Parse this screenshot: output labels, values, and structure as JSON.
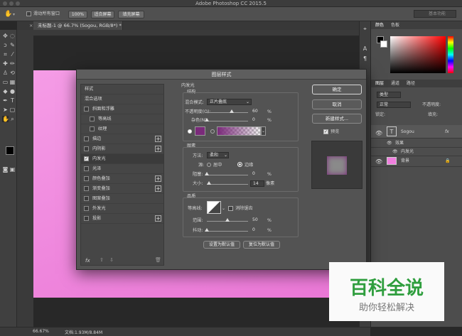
{
  "app": {
    "title": "Adobe Photoshop CC 2015.5"
  },
  "options_bar": {
    "scrub_zoom_label": "滑动所有窗口",
    "zoom_value": "100%",
    "fit_screen": "适合屏幕",
    "fill_screen": "填充屏幕",
    "workspace": "基本功能"
  },
  "document_tab": {
    "label": "未标题-1 @ 66.7% (Sogou, RGB/8*) *"
  },
  "dialog": {
    "title": "图层样式",
    "styles_header": "样式",
    "blend_options": "混合选项",
    "items": [
      {
        "label": "斜面和浮雕",
        "checked": false,
        "plus": false,
        "indent": false
      },
      {
        "label": "等高线",
        "checked": false,
        "plus": false,
        "indent": true
      },
      {
        "label": "纹理",
        "checked": false,
        "plus": false,
        "indent": true
      },
      {
        "label": "描边",
        "checked": false,
        "plus": true,
        "indent": false
      },
      {
        "label": "内阴影",
        "checked": false,
        "plus": true,
        "indent": false
      },
      {
        "label": "内发光",
        "checked": true,
        "plus": false,
        "indent": false
      },
      {
        "label": "光泽",
        "checked": false,
        "plus": false,
        "indent": false
      },
      {
        "label": "颜色叠加",
        "checked": false,
        "plus": true,
        "indent": false
      },
      {
        "label": "渐变叠加",
        "checked": false,
        "plus": true,
        "indent": false
      },
      {
        "label": "图案叠加",
        "checked": false,
        "plus": false,
        "indent": false
      },
      {
        "label": "外发光",
        "checked": false,
        "plus": false,
        "indent": false
      },
      {
        "label": "投影",
        "checked": false,
        "plus": true,
        "indent": false
      }
    ],
    "fx_label": "fx",
    "section_title": "内发光",
    "structure": {
      "title": "结构",
      "blend_mode_label": "混合模式:",
      "blend_mode_value": "正片叠底",
      "opacity_label": "不透明度(O):",
      "opacity_value": "60",
      "opacity_unit": "%",
      "opacity_level": 0.6,
      "noise_label": "杂色(N):",
      "noise_value": "0",
      "noise_unit": "%",
      "noise_level": 0,
      "color": "#7a2a7a"
    },
    "elements": {
      "title": "图素",
      "method_label": "方法:",
      "method_value": "柔和",
      "source_label": "源:",
      "center_label": "居中",
      "edge_label": "边缘",
      "choke_label": "阻塞:",
      "choke_value": "0",
      "choke_unit": "%",
      "choke_level": 0,
      "size_label": "大小:",
      "size_value": "14",
      "size_unit": "像素",
      "size_level": 0.06
    },
    "quality": {
      "title": "品质",
      "contour_label": "等高线:",
      "antialias_label": "消除锯齿",
      "range_label": "范围:",
      "range_value": "50",
      "range_unit": "%",
      "range_level": 0.5,
      "jitter_label": "抖动:",
      "jitter_value": "0",
      "jitter_unit": "%",
      "jitter_level": 0
    },
    "make_default": "设置为默认值",
    "reset_default": "复位为默认值",
    "ok": "确定",
    "cancel": "取消",
    "new_style": "新建样式...",
    "preview_label": "预览"
  },
  "panels": {
    "color_tab": "颜色",
    "swatches_tab": "色板",
    "layers_tab": "图层",
    "channels_tab": "通道",
    "paths_tab": "路径",
    "kind_label": "类型",
    "blend_label": "正常",
    "opacity_label": "不透明度:",
    "lock_label": "锁定:",
    "fill_label": "填充:",
    "layers": [
      {
        "name": "Sogou",
        "type": "text",
        "fx": "fx"
      },
      {
        "name": "效果",
        "type": "effects"
      },
      {
        "name": "内发光",
        "type": "effect"
      },
      {
        "name": "背景",
        "type": "background"
      }
    ]
  },
  "status": {
    "zoom": "66.67%",
    "doc": "文档:1.93M/8.84M"
  },
  "watermark": {
    "title": "百科全说",
    "subtitle": "助你轻松解决"
  },
  "colors": {
    "canvas": "#f07fde",
    "accent": "#2f7ad1",
    "glow": "#7a2a7a"
  }
}
